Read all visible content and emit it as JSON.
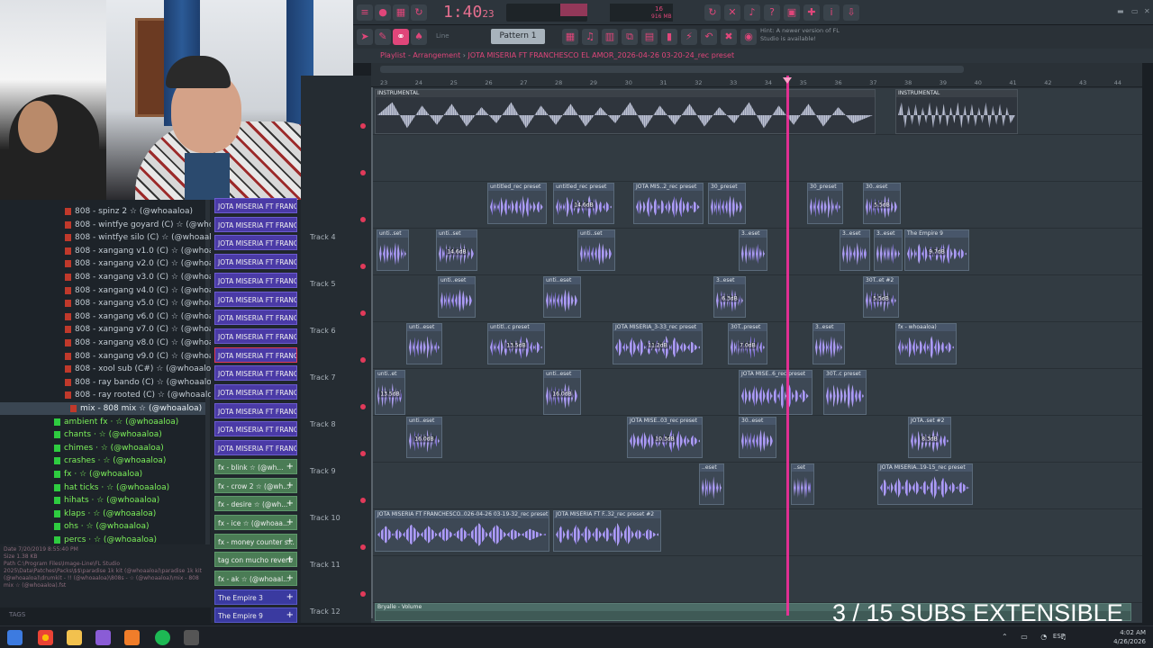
{
  "topbar": {
    "time": "1:40",
    "time_sub": "23",
    "cpu": "16",
    "mem": "916 MB",
    "pattern": "Pattern 1",
    "snap": "Line",
    "hint": "Hint: A newer version of FL Studio is available!"
  },
  "playlist": {
    "title": "Playlist - Arrangement",
    "project": "JOTA MISERIA FT FRANCHESCO EL AMOR_2026-04-26 03-20-24_rec preset"
  },
  "ruler": [
    "23",
    "24",
    "25",
    "26",
    "27",
    "28",
    "29",
    "30",
    "31",
    "32",
    "33",
    "34",
    "35",
    "36",
    "37",
    "38",
    "39",
    "40",
    "41",
    "42",
    "43",
    "44"
  ],
  "tracks": [
    "Track 4",
    "Track 5",
    "Track 6",
    "Track 7",
    "Track 8",
    "Track 9",
    "Track 10",
    "Track 11",
    "Track 12"
  ],
  "browser": {
    "items": [
      {
        "label": "808 - spinz 2 ☆ (@whoaaloa)",
        "green": false
      },
      {
        "label": "808 - wintfye goyard (C) ☆ (@whoaaloa)",
        "green": false
      },
      {
        "label": "808 - wintfye silo (C) ☆ (@whoaaloa)",
        "green": false
      },
      {
        "label": "808 - xangang v1.0 (C) ☆ (@whoaaloa)",
        "green": false
      },
      {
        "label": "808 - xangang v2.0 (C) ☆ (@whoaaloa)",
        "green": false
      },
      {
        "label": "808 - xangang v3.0 (C) ☆ (@whoaaloa)",
        "green": false
      },
      {
        "label": "808 - xangang v4.0 (C) ☆ (@whoaaloa)",
        "green": false
      },
      {
        "label": "808 - xangang v5.0 (C) ☆ (@whoaaloa)",
        "green": false
      },
      {
        "label": "808 - xangang v6.0 (C) ☆ (@whoaaloa)",
        "green": false
      },
      {
        "label": "808 - xangang v7.0 (C) ☆ (@whoaaloa)",
        "green": false
      },
      {
        "label": "808 - xangang v8.0 (C) ☆ (@whoaaloa)",
        "green": false
      },
      {
        "label": "808 - xangang v9.0 (C) ☆ (@whoaaloa)",
        "green": false
      },
      {
        "label": "808 - xool sub (C#) ☆ (@whoaaloa)",
        "green": false
      },
      {
        "label": "808 - ray bando (C) ☆ (@whoaaloa)",
        "green": false
      },
      {
        "label": "808 - ray rooted (C) ☆ (@whoaaloa)",
        "green": false
      },
      {
        "label": "mix - 808 mix ☆ (@whoaaloa)",
        "green": false,
        "sel": true
      },
      {
        "label": "ambient fx · ☆ (@whoaaloa)",
        "green": true
      },
      {
        "label": "chants · ☆ (@whoaaloa)",
        "green": true
      },
      {
        "label": "chimes · ☆ (@whoaaloa)",
        "green": true
      },
      {
        "label": "crashes · ☆ (@whoaaloa)",
        "green": true
      },
      {
        "label": "fx · ☆ (@whoaaloa)",
        "green": true
      },
      {
        "label": "hat ticks · ☆ (@whoaaloa)",
        "green": true
      },
      {
        "label": "hihats · ☆ (@whoaaloa)",
        "green": true
      },
      {
        "label": "klaps · ☆ (@whoaaloa)",
        "green": true
      },
      {
        "label": "ohs · ☆ (@whoaaloa)",
        "green": true
      },
      {
        "label": "percs · ☆ (@whoaaloa)",
        "green": true
      }
    ]
  },
  "info": {
    "date": "Date 7/20/2019 8:55:40 PM",
    "size": "Size 1.38 KB",
    "path": "Path C:\\Program Files\\Image-Line\\FL Studio 2025\\Data\\Patches\\Packs\\$$\\paradise 1k kit (@whoaaloa)\\paradise 1k kit (@whoaaloa)\\drumkit - !! (@whoaaloa)\\808s - ☆ (@whoaaloa)\\mix - 808 mix ☆ (@whoaaloa).fst",
    "tags": "TAGS"
  },
  "patterns": [
    {
      "label": "JOTA MISERIA FT FRANCH...",
      "type": "p"
    },
    {
      "label": "JOTA MISERIA FT FRANCH...",
      "type": "p"
    },
    {
      "label": "JOTA MISERIA FT FRANCH...",
      "type": "p"
    },
    {
      "label": "JOTA MISERIA FT FRANCH...",
      "type": "p"
    },
    {
      "label": "JOTA MISERIA FT FRANCH...",
      "type": "p"
    },
    {
      "label": "JOTA MISERIA FT FRANCH...",
      "type": "p"
    },
    {
      "label": "JOTA MISERIA FT FRANCH...",
      "type": "p"
    },
    {
      "label": "JOTA MISERIA FT FRANCH...",
      "type": "p"
    },
    {
      "label": "JOTA MISERIA FT FRANCH...",
      "type": "p",
      "sel": true
    },
    {
      "label": "JOTA MISERIA FT FRANCH...",
      "type": "p"
    },
    {
      "label": "JOTA MISERIA FT FRANCH...",
      "type": "p"
    },
    {
      "label": "JOTA MISERIA FT FRANCH...",
      "type": "p"
    },
    {
      "label": "JOTA MISERIA FT FRANCH...",
      "type": "p"
    },
    {
      "label": "JOTA MISERIA FT FRANCH...",
      "type": "p"
    },
    {
      "label": "fx - blink ☆ (@wh...",
      "type": "g"
    },
    {
      "label": "fx - crow 2 ☆ (@wh...",
      "type": "g"
    },
    {
      "label": "fx - desire ☆ (@wh...",
      "type": "g"
    },
    {
      "label": "fx - ice ☆ (@whoaa...",
      "type": "g"
    },
    {
      "label": "fx - money counter s...",
      "type": "g"
    },
    {
      "label": "tag con mucho reverb",
      "type": "g"
    },
    {
      "label": "fx - ak ☆ (@whoaal...",
      "type": "g"
    },
    {
      "label": "The Empire 3",
      "type": "b"
    },
    {
      "label": "The Empire 9",
      "type": "b"
    }
  ],
  "clips": [
    {
      "label": "INSTRUMENTAL",
      "db": "",
      "style": "inst"
    },
    {
      "label": "INSTRUMENTAL",
      "db": "",
      "style": "inst"
    },
    {
      "label": "untitled_rec preset",
      "db": "",
      "style": "c"
    },
    {
      "label": "untitled_rec preset",
      "db": "14.6dB",
      "style": "c"
    },
    {
      "label": "JOTA MIS..2_rec preset",
      "db": "",
      "style": "c"
    },
    {
      "label": "30_preset",
      "db": "",
      "style": "c"
    },
    {
      "label": "30_preset",
      "db": "",
      "style": "c"
    },
    {
      "label": "30..eset",
      "db": "5.5dB",
      "style": "c"
    },
    {
      "label": "unti..set",
      "db": "",
      "style": "c"
    },
    {
      "label": "unti..set",
      "db": "14.6dB",
      "style": "c"
    },
    {
      "label": "unti..set",
      "db": "",
      "style": "c"
    },
    {
      "label": "3..eset",
      "db": "",
      "style": "c"
    },
    {
      "label": "3..eset",
      "db": "",
      "style": "c"
    },
    {
      "label": "3..eset",
      "db": "",
      "style": "c"
    },
    {
      "label": "The Empire 9",
      "db": "9.7dB",
      "style": "c"
    },
    {
      "label": "unti..eset",
      "db": "",
      "style": "c"
    },
    {
      "label": "unti..eset",
      "db": "",
      "style": "c"
    },
    {
      "label": "3..eset",
      "db": "6.3dB",
      "style": "c"
    },
    {
      "label": "30T..et #2",
      "db": "5.5dB",
      "style": "c"
    },
    {
      "label": "unti..eset",
      "db": "",
      "style": "c"
    },
    {
      "label": "untitl..c preset",
      "db": "13.5dB",
      "style": "c"
    },
    {
      "label": "JOTA MISERIA_3-33_rec preset",
      "db": "11.2dB",
      "style": "c"
    },
    {
      "label": "30T..preset",
      "db": "7.0dB",
      "style": "c"
    },
    {
      "label": "3..eset",
      "db": "",
      "style": "c"
    },
    {
      "label": "fx - whoaaloa)",
      "db": "",
      "style": "c"
    },
    {
      "label": "unti..et",
      "db": "13.5dB",
      "style": "c"
    },
    {
      "label": "unti..eset",
      "db": "16.0dB",
      "style": "c"
    },
    {
      "label": "JOTA MISE..6_rec preset",
      "db": "",
      "style": "c"
    },
    {
      "label": "30T..c preset",
      "db": "",
      "style": "c"
    },
    {
      "label": "unti..eset",
      "db": "16.0dB",
      "style": "c"
    },
    {
      "label": "JOTA MISE..03_rec preset",
      "db": "10.3dB",
      "style": "c"
    },
    {
      "label": "30..eset",
      "db": "",
      "style": "c"
    },
    {
      "label": "JOTA..set #2",
      "db": "8.3dB",
      "style": "c"
    },
    {
      "label": "..eset",
      "db": "",
      "style": "c"
    },
    {
      "label": "..set",
      "db": "",
      "style": "c"
    },
    {
      "label": "JOTA MISERIA..19-15_rec preset",
      "db": "",
      "style": "c"
    },
    {
      "label": "JOTA MISERIA FT FRANCHESCO..026-04-26 03-19-32_rec preset",
      "db": "",
      "style": "c"
    },
    {
      "label": "JOTA MISERIA FT F..32_rec preset #2",
      "db": "",
      "style": "c"
    },
    {
      "label": "Bryalle - Volume",
      "db": "",
      "style": "auto"
    }
  ],
  "overlay": {
    "text": "3 / 15 SUBS EXTENSIBLE"
  },
  "taskbar": {
    "lang": "ESP",
    "time": "4:02 AM",
    "date": "4/26/2026"
  }
}
